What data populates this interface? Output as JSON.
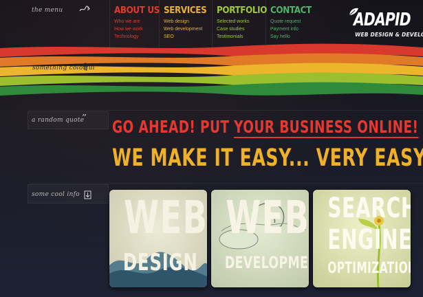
{
  "menu": {
    "label": "the menu",
    "icon": "scribble-arrow-icon"
  },
  "nav": [
    {
      "title": "ABOUT US",
      "color": "#e0392e",
      "links": [
        "Who we are",
        "How we work",
        "Technology"
      ]
    },
    {
      "title": "SERVICES",
      "color": "#e9b12a",
      "links": [
        "Web design",
        "Web development",
        "SEO"
      ]
    },
    {
      "title": "PORTFOLIO",
      "color": "#9ec93a",
      "links": [
        "Selected works",
        "Case studies",
        "Testimonials"
      ]
    },
    {
      "title": "CONTACT",
      "color": "#4fb36b",
      "links": [
        "Quote request",
        "Payment info",
        "Say hello"
      ]
    }
  ],
  "logo": {
    "word": "ADAPID",
    "tagline": "WEB DESIGN & DEVELOPMENT"
  },
  "stripes": {
    "label": "something colorful",
    "colors": [
      "#d8392c",
      "#e07a27",
      "#ecb52b",
      "#9bbf2f",
      "#2f8a3a"
    ]
  },
  "quote": {
    "label": "a random quote",
    "icon": "quote-marks-icon",
    "line1_part1": "GO AHEAD! PUT ",
    "line1_highlight": "YOUR BUSINESS ONLINE!",
    "line2": "WE MAKE IT EASY... VERY EASY!"
  },
  "info": {
    "label": "some cool info",
    "icon": "download-box-icon"
  },
  "cards": [
    {
      "line1": "WEB",
      "line2": "DESIGN"
    },
    {
      "line1": "WEB",
      "line2": "DEVELOPMENT"
    },
    {
      "line1": "SEARCH",
      "line2": "ENGINE",
      "line3": "OPTIMIZATION"
    }
  ]
}
